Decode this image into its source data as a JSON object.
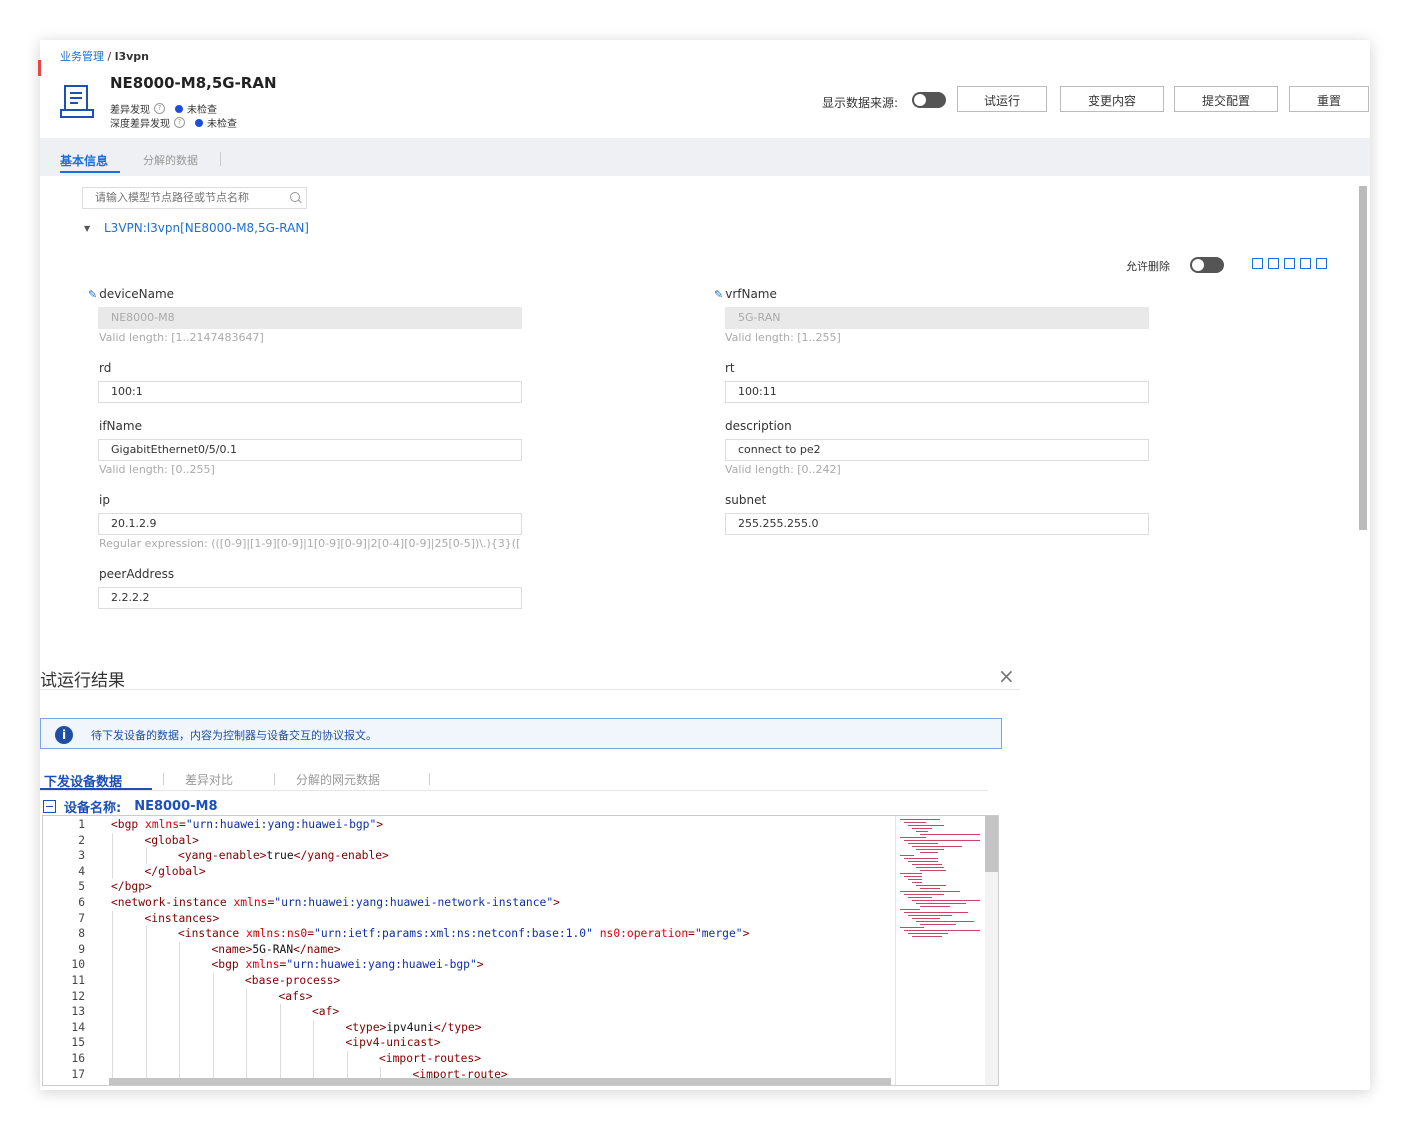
{
  "breadcrumb": {
    "parent": "业务管理",
    "sep": " / ",
    "current": "l3vpn"
  },
  "device": {
    "title": "NE8000-M8,5G-RAN",
    "status1_label": "差异发现",
    "status1_value": "未检查",
    "status2_label": "深度差异发现",
    "status2_value": "未检查"
  },
  "toolbar": {
    "show_source_label": "显示数据来源:",
    "trial_run": "试运行",
    "change_content": "变更内容",
    "submit_config": "提交配置",
    "reset": "重置"
  },
  "tabs": {
    "basic_info": "基本信息",
    "decomposed_data": "分解的数据"
  },
  "search": {
    "placeholder": "请输入模型节点路径或节点名称"
  },
  "tree": {
    "node_label": "L3VPN:l3vpn[NE8000-M8,5G-RAN]"
  },
  "form": {
    "allow_delete_label": "允许删除",
    "deviceName": {
      "label": "deviceName",
      "value": "NE8000-M8",
      "hint": "Valid length: [1..2147483647]"
    },
    "vrfName": {
      "label": "vrfName",
      "value": "5G-RAN",
      "hint": "Valid length: [1..255]"
    },
    "rd": {
      "label": "rd",
      "value": "100:1"
    },
    "rt": {
      "label": "rt",
      "value": "100:11"
    },
    "ifName": {
      "label": "ifName",
      "value": "GigabitEthernet0/5/0.1",
      "hint": "Valid length: [0..255]"
    },
    "description": {
      "label": "description",
      "value": "connect to pe2",
      "hint": "Valid length: [0..242]"
    },
    "ip": {
      "label": "ip",
      "value": "20.1.2.9",
      "hint": "Regular expression: (([0-9]|[1-9][0-9]|1[0-9][0-9]|2[0-4][0-9]|25[0-5])\\.){3}(["
    },
    "subnet": {
      "label": "subnet",
      "value": "255.255.255.0"
    },
    "peerAddress": {
      "label": "peerAddress",
      "value": "2.2.2.2"
    }
  },
  "dialog": {
    "title": "试运行结果",
    "close_symbol": "×",
    "info_icon": "i",
    "info_text": "待下发设备的数据，内容为控制器与设备交互的协议报文。",
    "tabs": [
      "下发设备数据",
      "差异对比",
      "分解的网元数据"
    ],
    "device_name_label": "设备名称:",
    "device_name_value": "NE8000-M8"
  },
  "code_lines": [
    {
      "n": "1",
      "indent": 0,
      "parts": [
        [
          "t",
          "<bgp "
        ],
        [
          "a",
          "xmlns"
        ],
        [
          "t",
          "="
        ],
        [
          "v",
          "\"urn:huawei:yang:huawei-bgp\""
        ],
        [
          "t",
          ">"
        ]
      ]
    },
    {
      "n": "2",
      "indent": 1,
      "parts": [
        [
          "t",
          "<global>"
        ]
      ]
    },
    {
      "n": "3",
      "indent": 2,
      "parts": [
        [
          "t",
          "<yang-enable>"
        ],
        [
          "x",
          "true"
        ],
        [
          "t",
          "</yang-enable>"
        ]
      ]
    },
    {
      "n": "4",
      "indent": 1,
      "parts": [
        [
          "t",
          "</global>"
        ]
      ]
    },
    {
      "n": "5",
      "indent": 0,
      "parts": [
        [
          "t",
          "</bgp>"
        ]
      ]
    },
    {
      "n": "6",
      "indent": 0,
      "parts": [
        [
          "t",
          "<network-instance "
        ],
        [
          "a",
          "xmlns"
        ],
        [
          "t",
          "="
        ],
        [
          "v",
          "\"urn:huawei:yang:huawei-network-instance\""
        ],
        [
          "t",
          ">"
        ]
      ]
    },
    {
      "n": "7",
      "indent": 1,
      "parts": [
        [
          "t",
          "<instances>"
        ]
      ]
    },
    {
      "n": "8",
      "indent": 2,
      "parts": [
        [
          "t",
          "<instance "
        ],
        [
          "a",
          "xmlns:ns0"
        ],
        [
          "t",
          "="
        ],
        [
          "v",
          "\"urn:ietf:params:xml:ns:netconf:base:1.0\""
        ],
        [
          "x",
          " "
        ],
        [
          "a",
          "ns0:operation"
        ],
        [
          "t",
          "="
        ],
        [
          "v",
          "\"merge\""
        ],
        [
          "t",
          ">"
        ]
      ]
    },
    {
      "n": "9",
      "indent": 3,
      "parts": [
        [
          "t",
          "<name>"
        ],
        [
          "x",
          "5G-RAN"
        ],
        [
          "t",
          "</name>"
        ]
      ]
    },
    {
      "n": "10",
      "indent": 3,
      "parts": [
        [
          "t",
          "<bgp "
        ],
        [
          "a",
          "xmlns"
        ],
        [
          "t",
          "="
        ],
        [
          "v",
          "\"urn:huawei:yang:huawei-bgp\""
        ],
        [
          "t",
          ">"
        ]
      ]
    },
    {
      "n": "11",
      "indent": 4,
      "parts": [
        [
          "t",
          "<base-process>"
        ]
      ]
    },
    {
      "n": "12",
      "indent": 5,
      "parts": [
        [
          "t",
          "<afs>"
        ]
      ]
    },
    {
      "n": "13",
      "indent": 6,
      "parts": [
        [
          "t",
          "<af>"
        ]
      ]
    },
    {
      "n": "14",
      "indent": 7,
      "parts": [
        [
          "t",
          "<type>"
        ],
        [
          "x",
          "ipv4uni"
        ],
        [
          "t",
          "</type>"
        ]
      ]
    },
    {
      "n": "15",
      "indent": 7,
      "parts": [
        [
          "t",
          "<ipv4-unicast>"
        ]
      ]
    },
    {
      "n": "16",
      "indent": 8,
      "parts": [
        [
          "t",
          "<import-routes>"
        ]
      ]
    },
    {
      "n": "17",
      "indent": 9,
      "parts": [
        [
          "t",
          "<import-route>"
        ]
      ]
    }
  ],
  "colors": {
    "accent": "#1c6fd8",
    "tag": "#800000",
    "attr": "#d4000a",
    "value": "#0f2fa8"
  }
}
